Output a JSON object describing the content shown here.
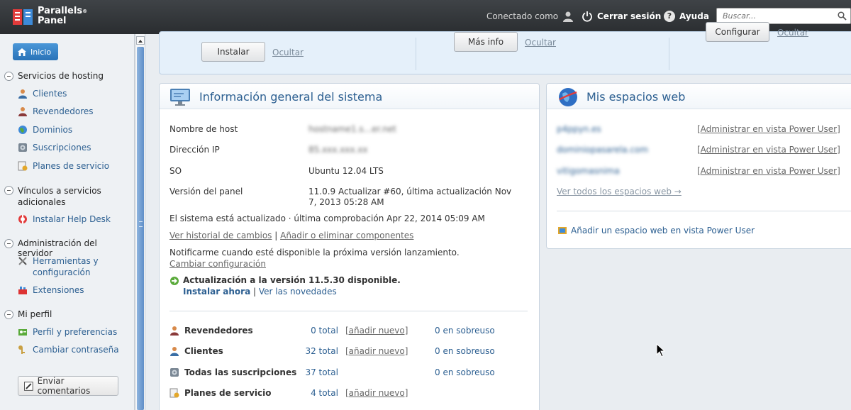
{
  "app": {
    "logo_line1": "Parallels",
    "logo_line2": "Panel",
    "logo_mark": "®"
  },
  "header": {
    "connected_as": "Conectado como",
    "logout": "Cerrar sesión",
    "help": "Ayuda",
    "search_placeholder": "Buscar..."
  },
  "sidebar": {
    "home": "Inicio",
    "sections": [
      {
        "title": "Servicios de hosting",
        "items": [
          "Clientes",
          "Revendedores",
          "Dominios",
          "Suscripciones",
          "Planes de servicio"
        ]
      },
      {
        "title": "Vínculos a servicios adicionales",
        "items": [
          "Instalar Help Desk"
        ]
      },
      {
        "title": "Administración del servidor",
        "items": [
          "Herramientas y configuración",
          "Extensiones"
        ]
      },
      {
        "title": "Mi perfil",
        "items": [
          "Perfil y preferencias",
          "Cambiar contraseña"
        ]
      }
    ],
    "feedback": "Enviar comentarios"
  },
  "banner": {
    "install_btn": "Instalar",
    "hide1": "Ocultar",
    "more_info_btn": "Más info",
    "hide2": "Ocultar",
    "configure_btn": "Configurar",
    "hide3": "Ocultar"
  },
  "system_info": {
    "title": "Información general del sistema",
    "hostname_label": "Nombre de host",
    "hostname_value": "hostname1.s...er.net",
    "ip_label": "Dirección IP",
    "ip_value": "85.xxx.xxx.xx",
    "os_label": "SO",
    "os_value": "Ubuntu 12.04 LTS",
    "version_label": "Versión del panel",
    "version_value": "11.0.9 Actualizar #60, última actualización Nov 7, 2013 05:28 AM",
    "update_status": "El sistema está actualizado · última comprobación Apr 22, 2014 05:09 AM",
    "history_link": "Ver historial de cambios",
    "components_link": "Añadir o eliminar componentes",
    "notify_text": "Notificarme cuando esté disponible la próxima versión lanzamiento.",
    "change_config": "Cambiar configuración",
    "upgrade_available": "Actualización a la versión 11.5.30 disponible.",
    "install_now": "Instalar ahora",
    "whats_new": "Ver las novedades",
    "stats": [
      {
        "label": "Revendedores",
        "total": "0 total",
        "add": "[añadir nuevo]",
        "over": "0 en sobreuso"
      },
      {
        "label": "Clientes",
        "total": "32 total",
        "add": "[añadir nuevo]",
        "over": "0 en sobreuso"
      },
      {
        "label": "Todas las suscripciones",
        "total": "37 total",
        "add": "",
        "over": "0 en sobreuso"
      },
      {
        "label": "Planes de servicio",
        "total": "4 total",
        "add": "[añadir nuevo]",
        "over": ""
      }
    ]
  },
  "webspaces": {
    "title": "Mis espacios web",
    "entries": [
      {
        "name": "p4ppyn.es",
        "action": "[Administrar en vista Power User]"
      },
      {
        "name": "dominiopasarela.com",
        "action": "[Administrar en vista Power User]"
      },
      {
        "name": "vitigomasnima",
        "action": "[Administrar en vista Power User]"
      }
    ],
    "view_all": "Ver todos los espacios web →",
    "add_webspace": "Añadir un espacio web en vista Power User"
  }
}
